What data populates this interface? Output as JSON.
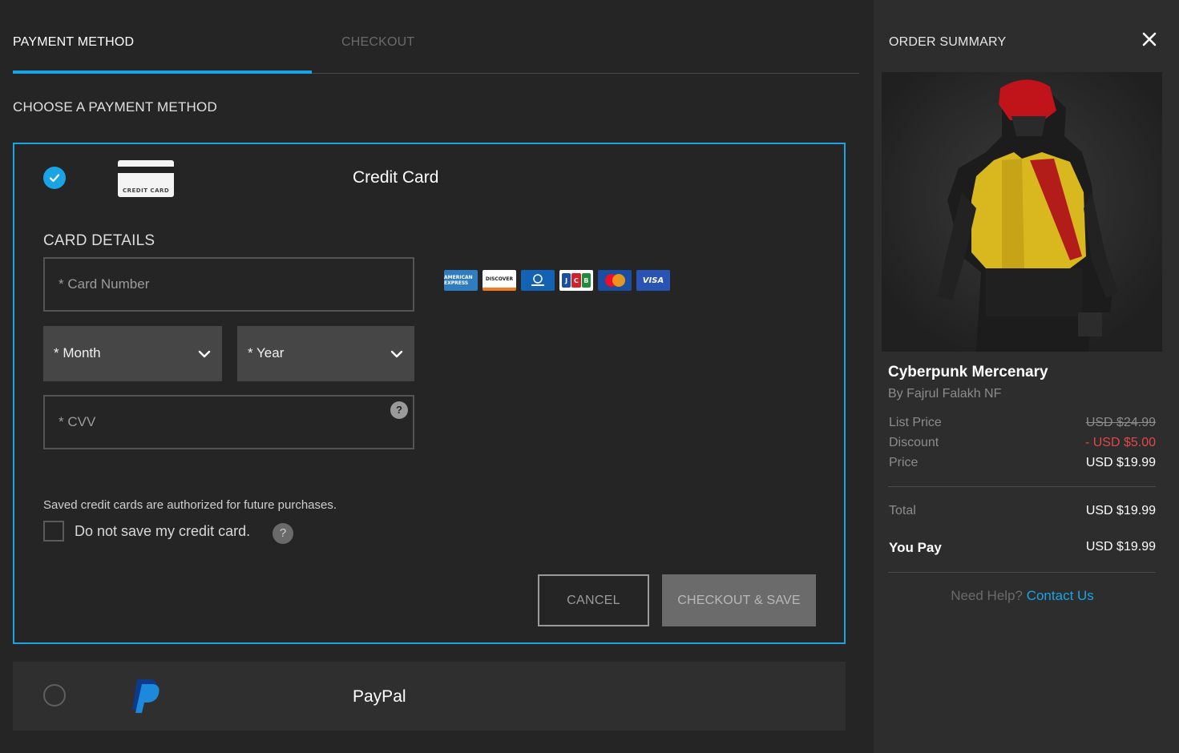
{
  "tabs": {
    "payment_method": "PAYMENT METHOD",
    "checkout": "CHECKOUT"
  },
  "section_title": "CHOOSE A PAYMENT METHOD",
  "credit_card": {
    "selected": true,
    "icon_text": "CREDIT CARD",
    "label": "Credit Card",
    "card_details_title": "CARD DETAILS",
    "card_number_placeholder": "* Card Number",
    "month_label": "* Month",
    "year_label": "* Year",
    "cvv_placeholder": "* CVV",
    "cvv_help": "?",
    "accepted_cards": {
      "amex": "AMERICAN EXPRESS",
      "discover": "DISCOVER",
      "diners": "Diners Club",
      "jcb": [
        "J",
        "C",
        "B"
      ],
      "mastercard": "mastercard",
      "visa": "VISA"
    },
    "save_note": "Saved credit cards are authorized for future purchases.",
    "do_not_save_label": "Do not save my credit card.",
    "do_not_save_checked": false,
    "do_not_save_help": "?",
    "cancel_label": "CANCEL",
    "checkout_save_label": "CHECKOUT & SAVE"
  },
  "paypal": {
    "selected": false,
    "label": "PayPal"
  },
  "summary": {
    "title": "ORDER SUMMARY",
    "close": "×",
    "product_name": "Cyberpunk Mercenary",
    "product_author": "By Fajrul Falakh NF",
    "list_price_label": "List Price",
    "list_price_value": "USD $24.99",
    "discount_label": "Discount",
    "discount_value": "- USD $5.00",
    "price_label": "Price",
    "price_value": "USD $19.99",
    "total_label": "Total",
    "total_value": "USD $19.99",
    "you_pay_label": "You Pay",
    "you_pay_value": "USD $19.99",
    "help_question": "Need Help?",
    "help_link": "Contact Us"
  },
  "colors": {
    "accent": "#1aa4e6",
    "discount_red": "#e04848",
    "background": "#252525",
    "summary_background": "#2d2d2d"
  }
}
